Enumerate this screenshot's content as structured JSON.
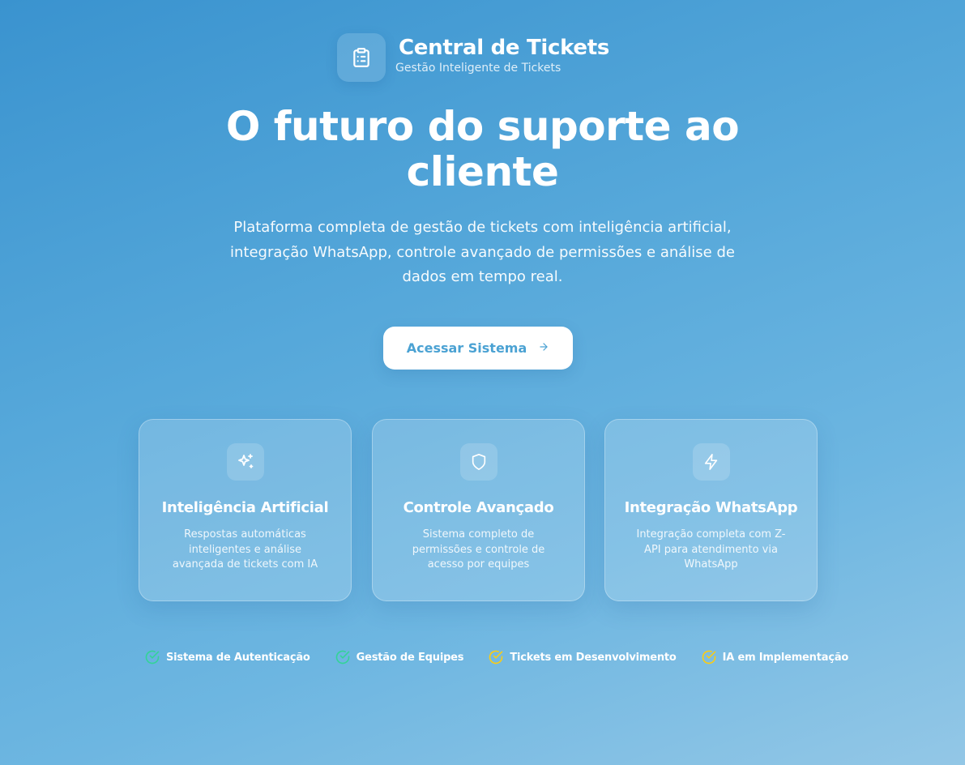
{
  "brand": {
    "title": "Central de Tickets",
    "subtitle": "Gestão Inteligente de Tickets",
    "logo_icon": "clipboard-list-icon"
  },
  "hero": {
    "title_line1": "O futuro do suporte ao",
    "title_line2": "cliente",
    "description": "Plataforma completa de gestão de tickets com inteligência artificial, integração WhatsApp, controle avançado de permissões e análise de dados em tempo real."
  },
  "cta": {
    "label": "Acessar Sistema",
    "icon": "arrow-right-icon",
    "text_color": "#4ba2d3"
  },
  "features": [
    {
      "icon": "sparkles-icon",
      "title": "Inteligência Artificial",
      "description": "Respostas automáticas inteligentes e análise avançada de tickets com IA"
    },
    {
      "icon": "shield-icon",
      "title": "Controle Avançado",
      "description": "Sistema completo de permissões e controle de acesso por equipes"
    },
    {
      "icon": "lightning-icon",
      "title": "Integração WhatsApp",
      "description": "Integração completa com Z-API para atendimento via WhatsApp"
    }
  ],
  "status_items": [
    {
      "label": "Sistema de Autenticação",
      "icon": "check-circle-icon",
      "color": "#34d399"
    },
    {
      "label": "Gestão de Equipes",
      "icon": "check-circle-icon",
      "color": "#34d399"
    },
    {
      "label": "Tickets em Desenvolvimento",
      "icon": "check-circle-icon",
      "color": "#facc15"
    },
    {
      "label": "IA em Implementação",
      "icon": "check-circle-icon",
      "color": "#facc15"
    }
  ],
  "colors": {
    "background_start": "#3a93cf",
    "background_end": "#93c7e6",
    "done": "#34d399",
    "in_progress": "#facc15"
  }
}
